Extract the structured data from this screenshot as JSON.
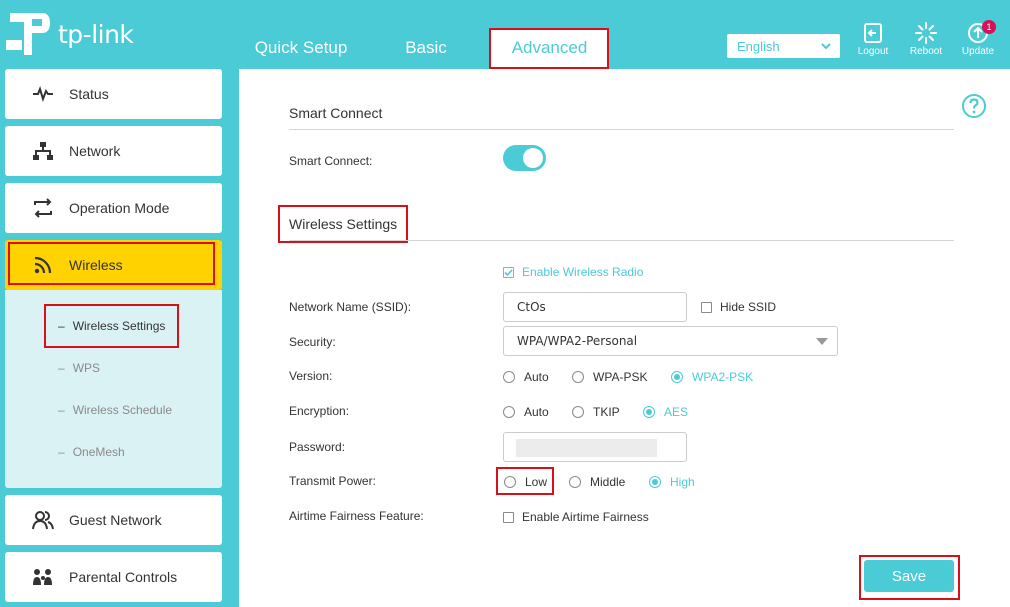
{
  "brand": {
    "logo_text": "tp-link"
  },
  "header": {
    "tabs": [
      {
        "label": "Quick Setup"
      },
      {
        "label": "Basic"
      },
      {
        "label": "Advanced"
      }
    ],
    "active_tab": "Advanced",
    "language": "English",
    "actions": [
      {
        "label": "Logout",
        "icon": "logout-icon"
      },
      {
        "label": "Reboot",
        "icon": "reboot-icon"
      },
      {
        "label": "Update",
        "icon": "update-icon",
        "badge": "1"
      }
    ]
  },
  "sidebar": {
    "items": [
      {
        "label": "Status",
        "icon": "pulse-icon"
      },
      {
        "label": "Network",
        "icon": "network-icon"
      },
      {
        "label": "Operation Mode",
        "icon": "swap-arrows-icon"
      },
      {
        "label": "Wireless",
        "icon": "wifi-icon"
      },
      {
        "label": "Guest Network",
        "icon": "users-icon"
      },
      {
        "label": "Parental Controls",
        "icon": "family-icon"
      }
    ],
    "active_item": "Wireless",
    "sub_items": [
      {
        "label": "Wireless Settings"
      },
      {
        "label": "WPS"
      },
      {
        "label": "Wireless Schedule"
      },
      {
        "label": "OneMesh"
      }
    ],
    "active_sub_item": "Wireless Settings"
  },
  "smart_connect": {
    "title": "Smart Connect",
    "label": "Smart Connect:",
    "enabled": true
  },
  "wireless_settings": {
    "title": "Wireless Settings",
    "enable_radio_label": "Enable Wireless Radio",
    "enable_radio_checked": true,
    "ssid_label": "Network Name (SSID):",
    "ssid_value": "CtOs",
    "hide_ssid_label": "Hide SSID",
    "hide_ssid_checked": false,
    "security_label": "Security:",
    "security_value": "WPA/WPA2-Personal",
    "version_label": "Version:",
    "version_options": [
      "Auto",
      "WPA-PSK",
      "WPA2-PSK"
    ],
    "version_selected": "WPA2-PSK",
    "encryption_label": "Encryption:",
    "encryption_options": [
      "Auto",
      "TKIP",
      "AES"
    ],
    "encryption_selected": "AES",
    "password_label": "Password:",
    "transmit_label": "Transmit Power:",
    "transmit_options": [
      "Low",
      "Middle",
      "High"
    ],
    "transmit_selected": "High",
    "airtime_label": "Airtime Fairness Feature:",
    "airtime_checkbox_label": "Enable Airtime Fairness",
    "airtime_checked": false
  },
  "save_label": "Save",
  "colors": {
    "accent": "#4acbd6",
    "active_nav": "#ffd200",
    "highlight_box": "#d8101a",
    "badge": "#d8105a"
  }
}
